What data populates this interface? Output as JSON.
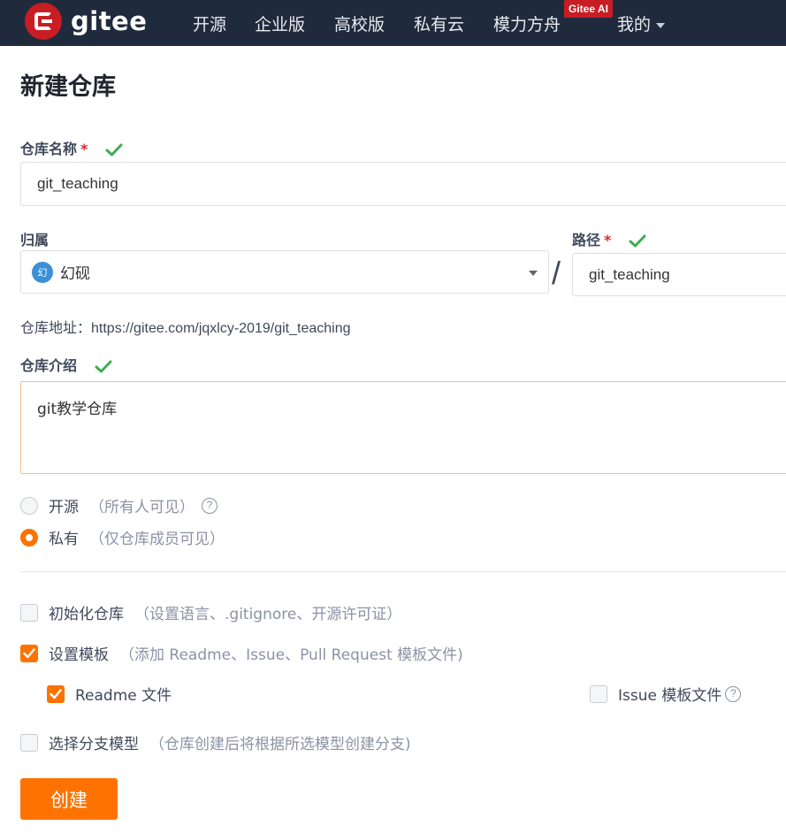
{
  "nav": {
    "brand": "gitee",
    "items": [
      "开源",
      "企业版",
      "高校版",
      "私有云",
      "模力方舟"
    ],
    "ai_badge": "Gitee AI",
    "mine": "我的"
  },
  "page": {
    "title": "新建仓库"
  },
  "form": {
    "repo_name_label": "仓库名称",
    "repo_name_value": "git_teaching",
    "owner_label": "归属",
    "owner_avatar_text": "幻",
    "owner_value": "幻砚",
    "path_label": "路径",
    "path_value": "git_teaching",
    "required_mark": "*",
    "separator": "/",
    "address_prefix": "仓库地址：",
    "address_url": "https://gitee.com/jqxlcy-2019/git_teaching",
    "intro_label": "仓库介绍",
    "intro_value": "git教学仓库"
  },
  "visibility": {
    "public_label": "开源",
    "public_hint": "（所有人可见）",
    "private_label": "私有",
    "private_hint": "（仅仓库成员可见）",
    "selected": "private",
    "help": "?"
  },
  "options": {
    "init_label": "初始化仓库",
    "init_hint": "（设置语言、.gitignore、开源许可证）",
    "init_checked": false,
    "template_label": "设置模板",
    "template_hint": "（添加 Readme、Issue、Pull Request 模板文件)",
    "template_checked": true,
    "readme_label": "Readme 文件",
    "readme_checked": true,
    "issue_label": "Issue 模板文件",
    "issue_checked": false,
    "branch_label": "选择分支模型",
    "branch_hint": "（仓库创建后将根据所选模型创建分支)",
    "branch_checked": false
  },
  "submit": {
    "label": "创建"
  },
  "colors": {
    "accent": "#fe7300",
    "nav_bg": "#1f2b3c",
    "brand_red": "#c71d23",
    "check_green": "#3fad52"
  }
}
